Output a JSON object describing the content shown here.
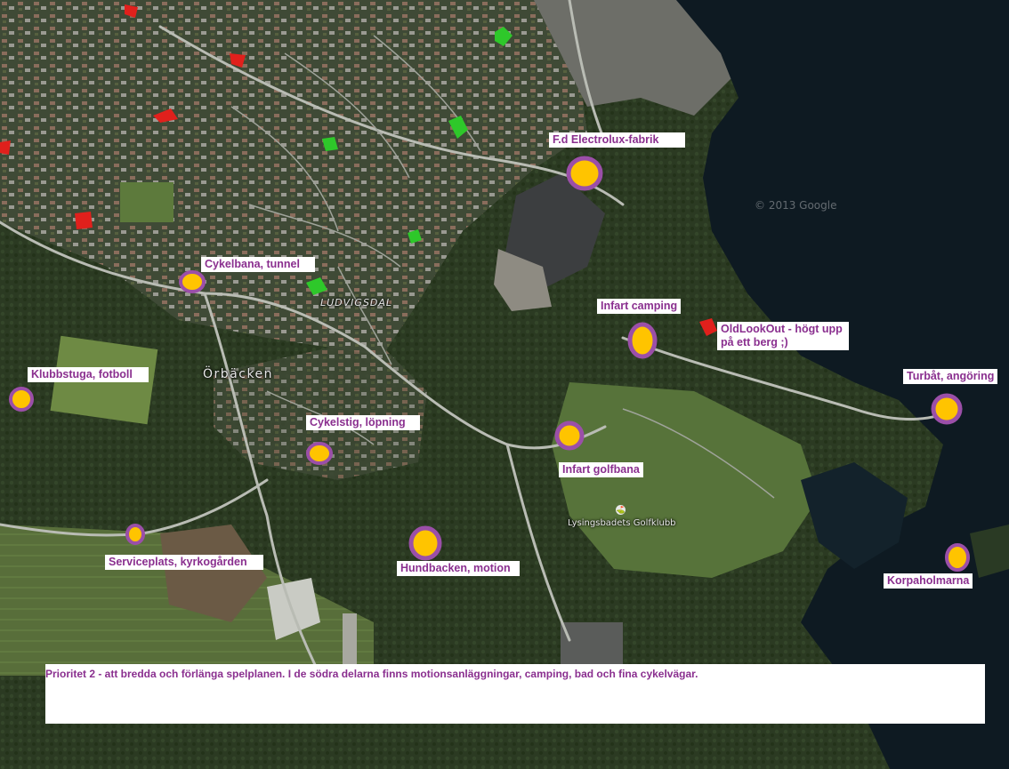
{
  "map": {
    "place_labels": {
      "ludvigsdal": "LUDVIGSDAL",
      "orbacken": "Örbäcken",
      "golf_club": "Lysingsbadets Golfklubb"
    },
    "watermark": "© 2013 Google",
    "water_color": "#0e1a22",
    "marker_fill": "#ffc400",
    "marker_ring": "#9b4fa8",
    "poi_label_color": "#8a2f8f"
  },
  "poi": {
    "electrolux": "F.d Electrolux-fabrik",
    "cykelbana": "Cykelbana, tunnel",
    "infart_camping": "Infart camping",
    "oldlookout": "OldLookOut - högt upp på ett berg ;)",
    "klubbstuga": "Klubbstuga, fotboll",
    "cykelstig": "Cykelstig, löpning",
    "infart_golfbana": "Infart golfbana",
    "turbat": "Turbåt, angöring",
    "serviceplats": "Serviceplats, kyrkogården",
    "hundbacken": "Hundbacken, motion",
    "korpaholmarna": "Korpaholmarna"
  },
  "note": {
    "text": "Prioritet 2 - att bredda och förlänga spelplanen. I de södra delarna finns motionsanläggningar, camping, bad och fina cykelvägar."
  }
}
